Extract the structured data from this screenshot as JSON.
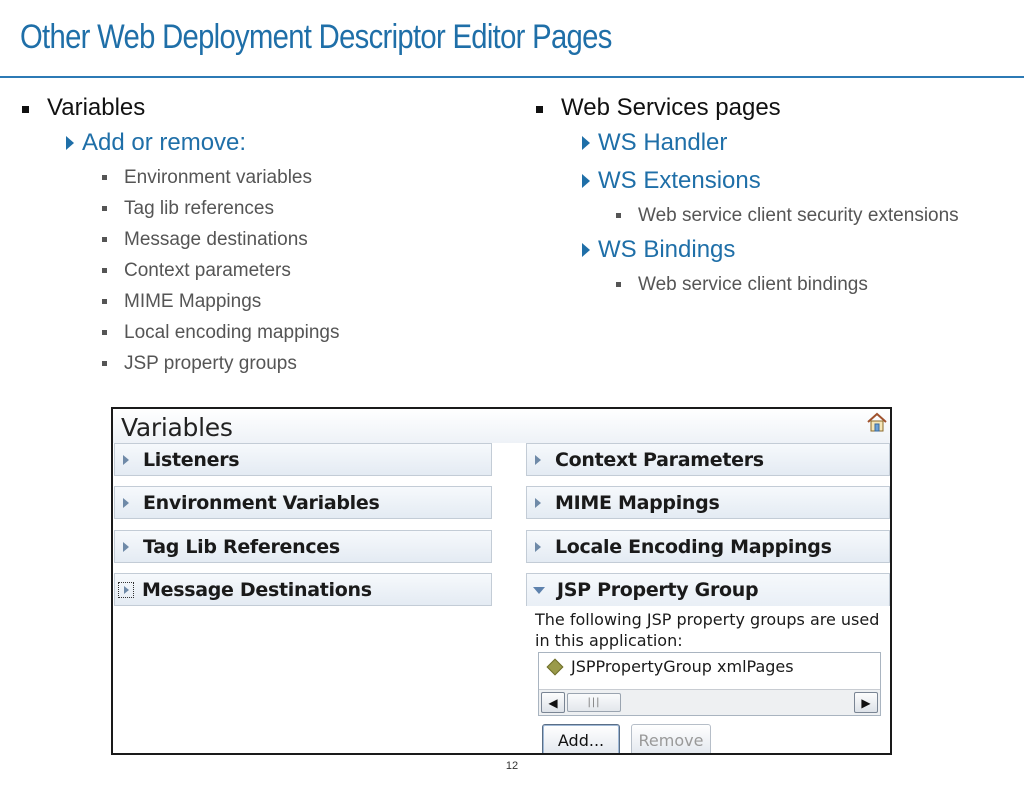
{
  "slide": {
    "title": "Other Web Deployment Descriptor Editor Pages",
    "page_number": "12"
  },
  "left_column": {
    "heading": "Variables",
    "sub_heading": "Add or remove:",
    "items": [
      "Environment variables",
      "Tag lib references",
      "Message destinations",
      "Context parameters",
      "MIME Mappings",
      "Local encoding mappings",
      "JSP property groups"
    ]
  },
  "right_column": {
    "heading": "Web Services pages",
    "ws_handler": "WS Handler",
    "ws_extensions": "WS Extensions",
    "ws_extensions_item": "Web service client security extensions",
    "ws_bindings": "WS Bindings",
    "ws_bindings_item": "Web service client bindings"
  },
  "panel": {
    "title": "Variables",
    "sections_left": [
      "Listeners",
      "Environment Variables",
      "Tag Lib References",
      "Message Destinations"
    ],
    "sections_right": [
      "Context Parameters",
      "MIME Mappings",
      "Locale Encoding Mappings",
      "JSP Property Group"
    ],
    "jsp_description": "The following JSP property groups are used in this application:",
    "jsp_item": "JSPPropertyGroup xmlPages",
    "add_button": "Add...",
    "remove_button": "Remove",
    "icons": [
      "home-icon",
      "chevron-right-icon",
      "chevron-down-icon",
      "property-group-icon",
      "scroll-left-icon",
      "scroll-right-icon"
    ]
  },
  "colors": {
    "title_blue": "#1f6fa8",
    "rule_blue": "#2c7ab5"
  }
}
